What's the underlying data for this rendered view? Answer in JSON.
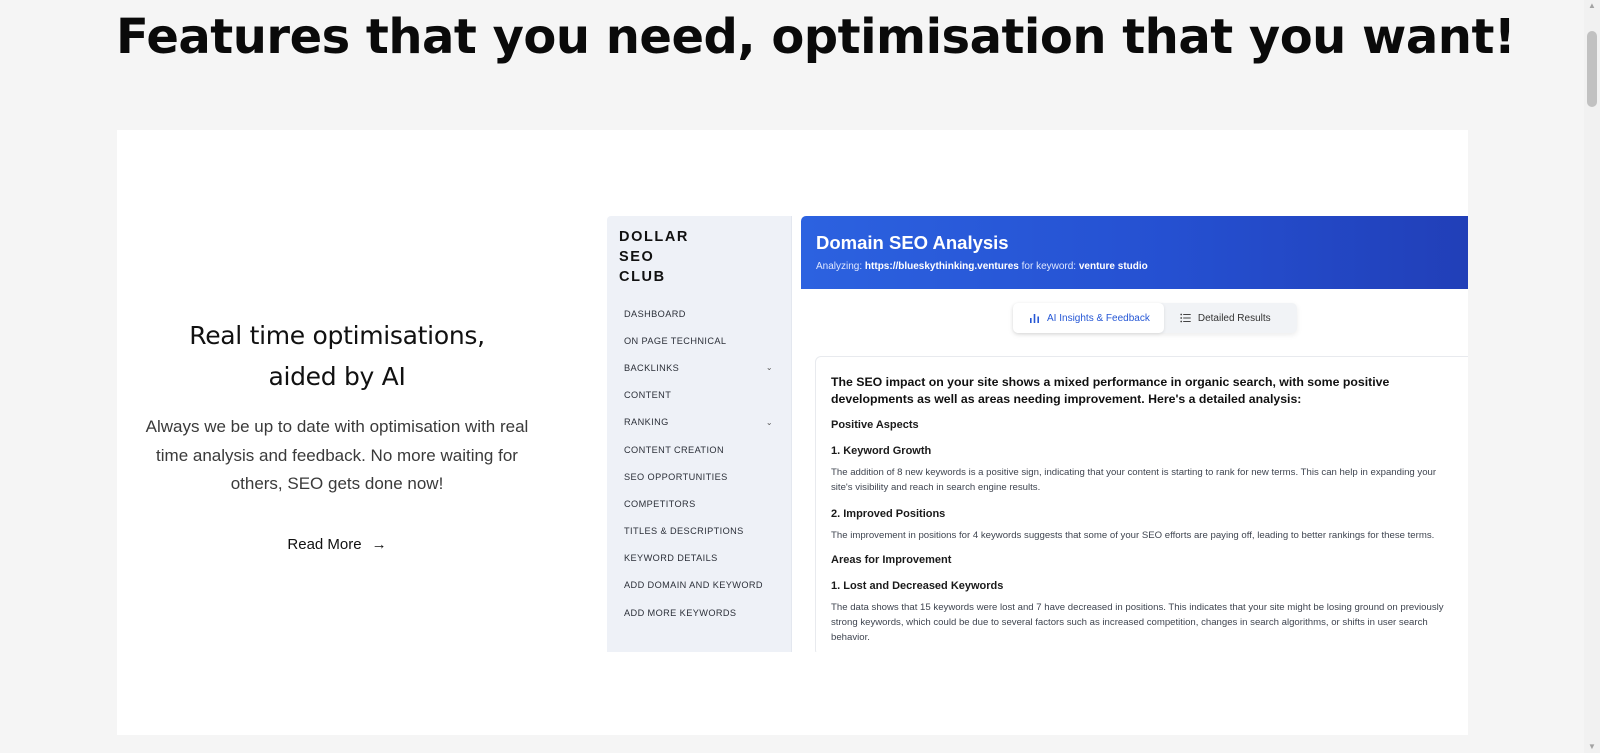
{
  "page": {
    "heading": "Features that you need, optimisation that you want!"
  },
  "feature": {
    "title_line1": "Real time optimisations,",
    "title_line2": "aided by AI",
    "description": "Always we be up to date with optimisation with real time analysis and feedback. No more waiting for others, SEO gets done now!",
    "read_more": "Read More",
    "arrow": "→"
  },
  "app": {
    "logo_lines": [
      "DOLLAR",
      "SEO",
      "CLUB"
    ],
    "nav": [
      {
        "label": "DASHBOARD",
        "chevron": ""
      },
      {
        "label": "ON PAGE TECHNICAL",
        "chevron": ""
      },
      {
        "label": "BACKLINKS",
        "chevron": "⌄"
      },
      {
        "label": "CONTENT",
        "chevron": ""
      },
      {
        "label": "RANKING",
        "chevron": "⌄"
      },
      {
        "label": "CONTENT CREATION",
        "chevron": ""
      },
      {
        "label": "SEO OPPORTUNITIES",
        "chevron": ""
      },
      {
        "label": "COMPETITORS",
        "chevron": ""
      },
      {
        "label": "TITLES & DESCRIPTIONS",
        "chevron": ""
      },
      {
        "label": "KEYWORD DETAILS",
        "chevron": ""
      },
      {
        "label": "ADD DOMAIN AND KEYWORD",
        "chevron": ""
      },
      {
        "label": "ADD MORE KEYWORDS",
        "chevron": ""
      }
    ],
    "header": {
      "title": "Domain SEO Analysis",
      "analyzing_label": "Analyzing:",
      "domain": "https://blueskythinking.ventures",
      "keyword_label": "for keyword:",
      "keyword": "venture studio"
    },
    "tabs": {
      "insights": "AI Insights & Feedback",
      "details": "Detailed Results"
    },
    "analysis": {
      "intro": "The SEO impact on your site shows a mixed performance in organic search, with some positive developments as well as areas needing improvement. Here's a detailed analysis:",
      "positive_heading": "Positive Aspects",
      "item1_title": "1. Keyword Growth",
      "item1_text": "The addition of 8 new keywords is a positive sign, indicating that your content is starting to rank for new terms. This can help in expanding your site's visibility and reach in search engine results.",
      "item2_title": "2. Improved Positions",
      "item2_text": "The improvement in positions for 4 keywords suggests that some of your SEO efforts are paying off, leading to better rankings for these terms.",
      "improve_heading": "Areas for Improvement",
      "item3_title": "1. Lost and Decreased Keywords",
      "item3_text": "The data shows that 15 keywords were lost and 7 have decreased in positions. This indicates that your site might be losing ground on previously strong keywords, which could be due to several factors such as increased competition, changes in search algorithms, or shifts in user search behavior."
    }
  },
  "colors": {
    "page_bg": "#f5f5f5",
    "card_bg": "#ffffff",
    "header_blue": "#2550d1",
    "tab_active_text": "#2557d6",
    "sidebar_bg": "#eef1f7"
  },
  "icons": {
    "bar_chart": "bar-chart-icon",
    "list": "list-icon",
    "arrow_right": "arrow-right-icon",
    "chevron_down": "chevron-down-icon"
  }
}
